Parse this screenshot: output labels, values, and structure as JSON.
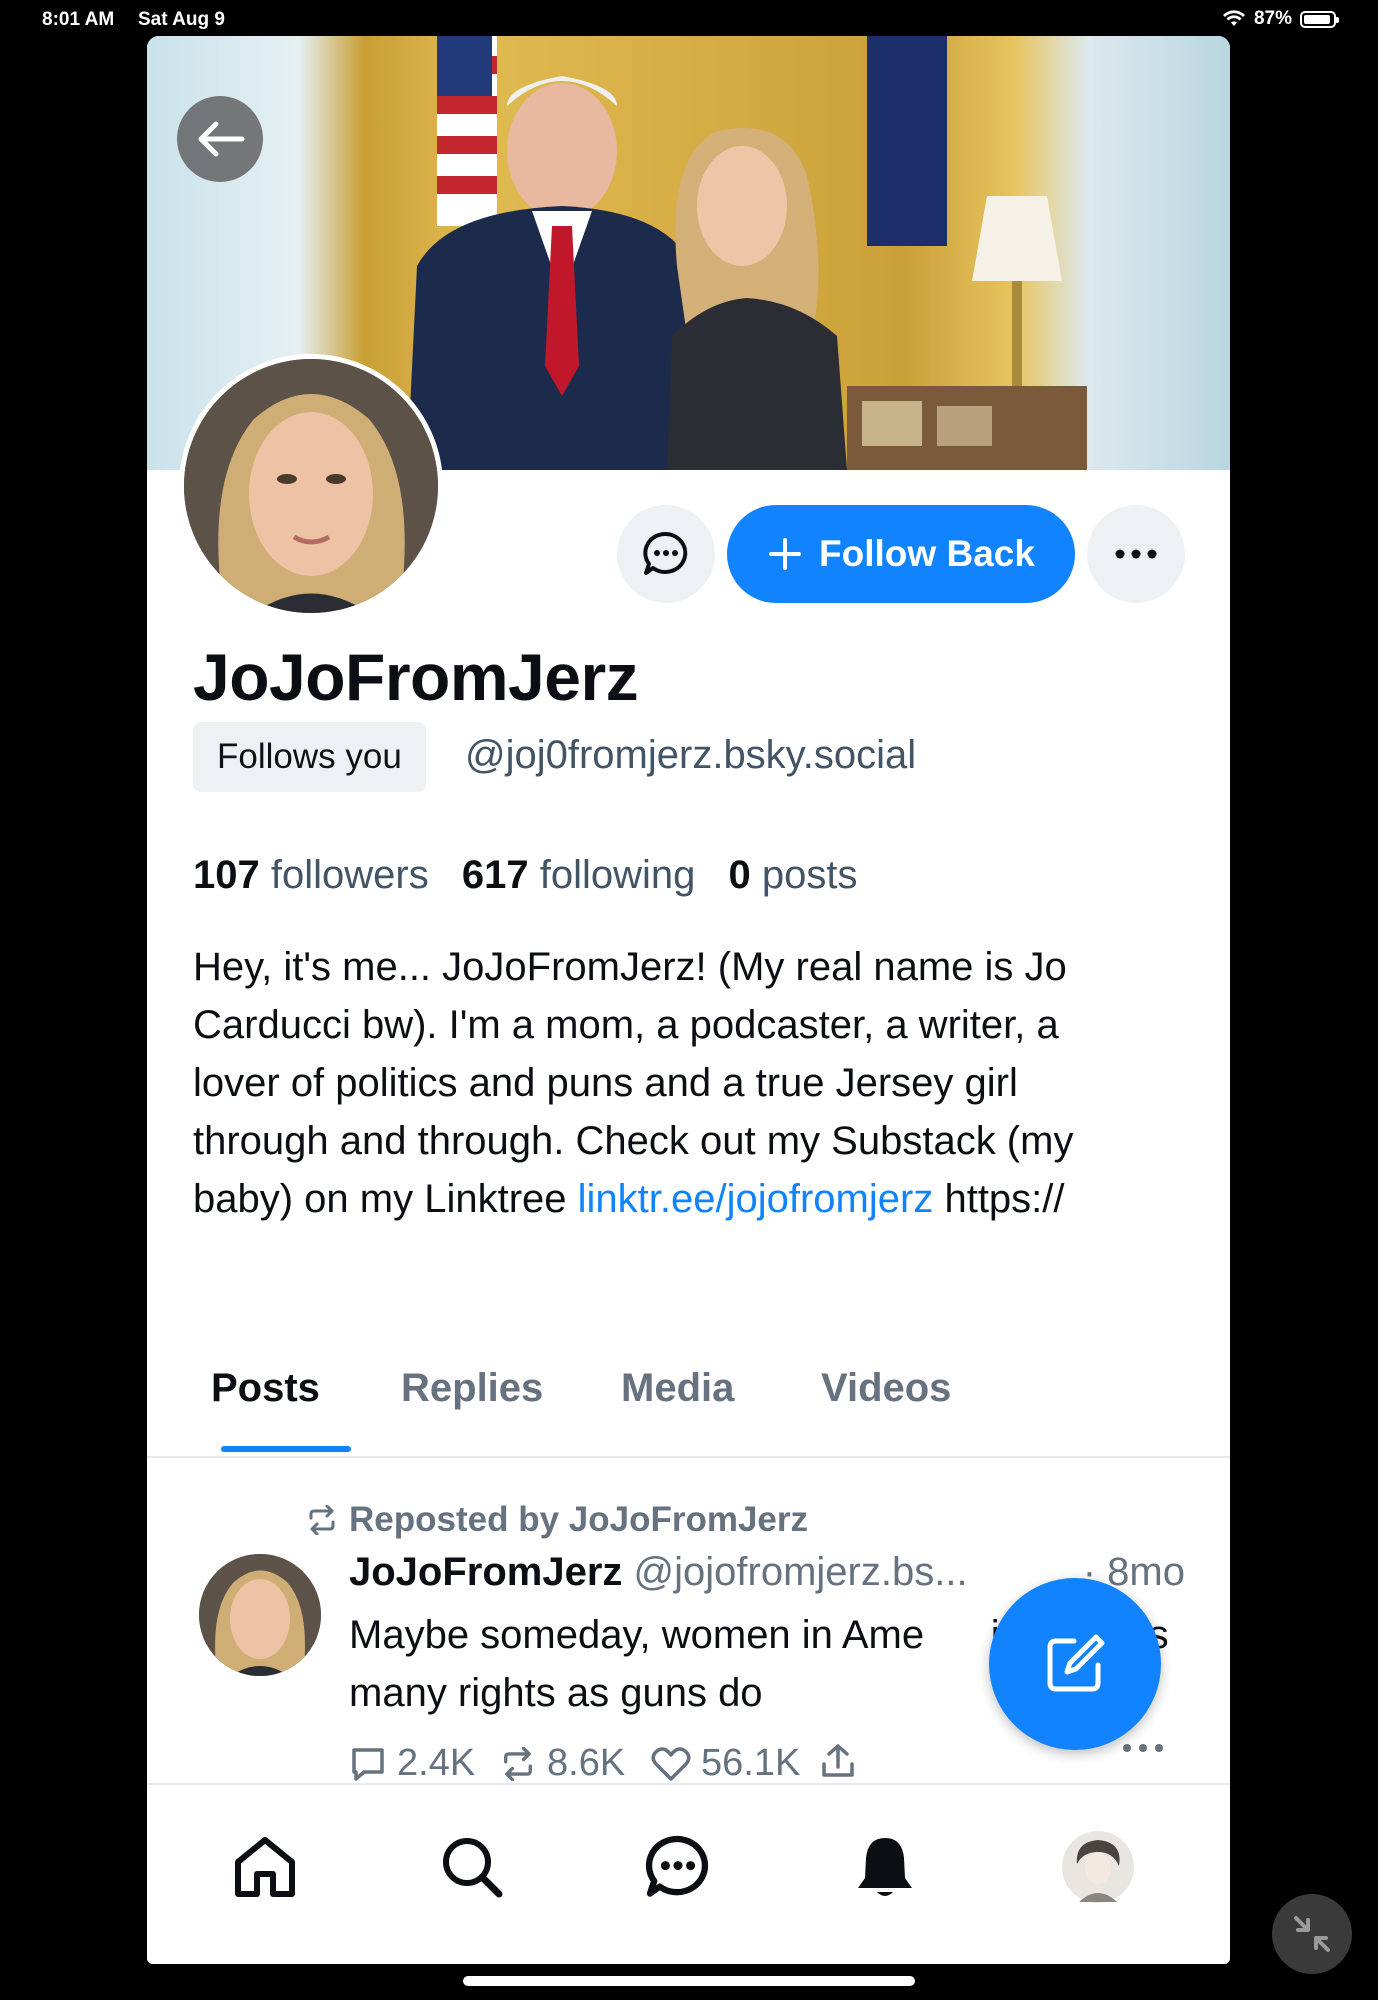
{
  "status_bar": {
    "time": "8:01 AM",
    "date": "Sat Aug 9",
    "battery": "87%"
  },
  "profile": {
    "display_name": "JoJoFromJerz",
    "follows_you": "Follows you",
    "handle": "@joj0fromjerz.bsky.social",
    "followers_count": "107",
    "followers_label": "followers",
    "following_count": "617",
    "following_label": "following",
    "posts_count": "0",
    "posts_label": "posts",
    "bio": "Hey, it's me... JoJoFromJerz! (My real name is Jo Carducci bw). I'm a mom, a podcaster, a writer, a lover of politics and puns and a true Jersey girl through and through. Check out my Substack (my baby) on my Linktree",
    "bio_link": "linktr.ee/jojofromjerz",
    "bio_tail": "https://"
  },
  "buttons": {
    "follow_back": "Follow Back"
  },
  "tabs": [
    {
      "label": "Posts"
    },
    {
      "label": "Replies"
    },
    {
      "label": "Media"
    },
    {
      "label": "Videos"
    }
  ],
  "post": {
    "repost_label": "Reposted by JoJoFromJerz",
    "author_name": "JoJoFromJerz",
    "author_handle": "@jojofromjerz.bs...",
    "time": "· 8mo",
    "text": "Maybe someday, women in Ame      ill have as many rights as guns do",
    "replies": "2.4K",
    "reposts": "8.6K",
    "likes": "56.1K"
  },
  "colors": {
    "accent": "#1183fe",
    "muted": "#66727f",
    "text": "#0b0f14"
  },
  "icons": [
    "back-arrow-icon",
    "chat-bubble-icon",
    "plus-icon",
    "ellipsis-icon",
    "repost-icon",
    "reply-icon",
    "like-icon",
    "share-icon",
    "compose-icon",
    "home-icon",
    "search-icon",
    "messages-icon",
    "bell-icon",
    "profile-avatar-icon",
    "minimize-icon",
    "wifi-icon",
    "battery-icon"
  ]
}
